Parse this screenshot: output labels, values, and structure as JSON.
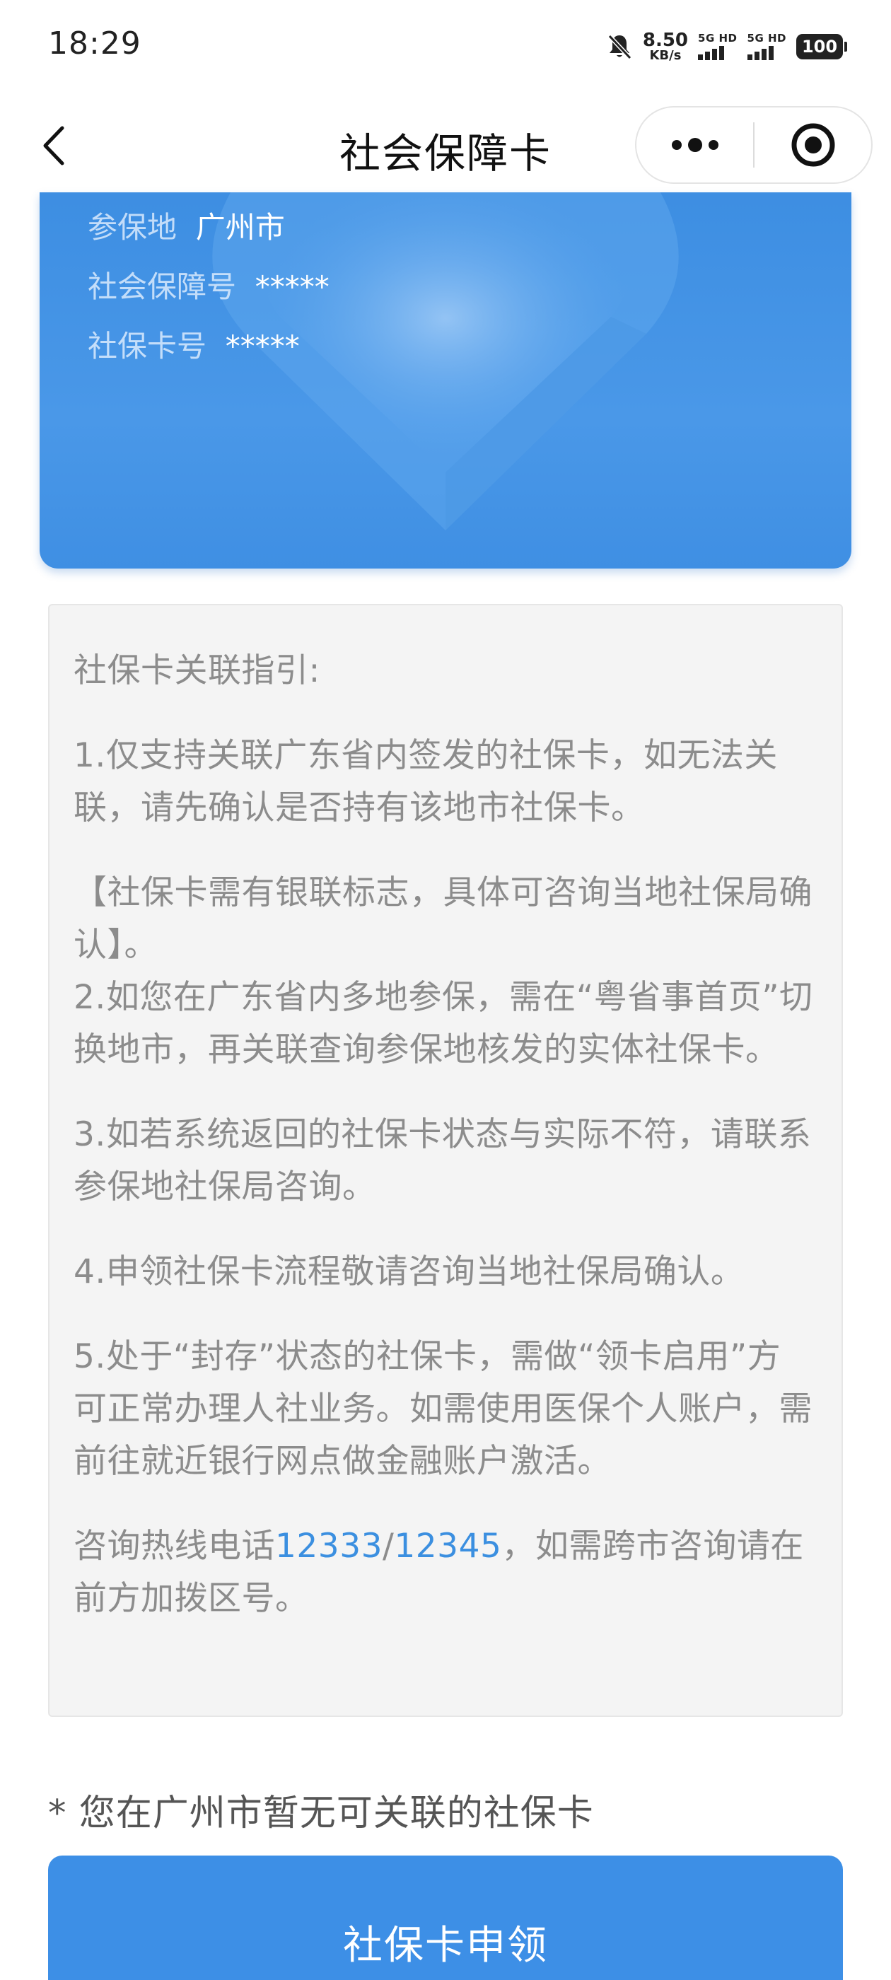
{
  "status_bar": {
    "time": "18:29",
    "net_speed_value": "8.50",
    "net_speed_unit": "KB/s",
    "signal1_label": "5G HD",
    "signal2_label": "5G HD",
    "battery": "100"
  },
  "nav": {
    "title": "社会保障卡"
  },
  "card": {
    "region_label": "参保地",
    "region_value": "广州市",
    "ss_number_label": "社会保障号",
    "ss_number_value": "*****",
    "card_number_label": "社保卡号",
    "card_number_value": "*****"
  },
  "guide": {
    "title": "社保卡关联指引:",
    "item1": "1.仅支持关联广东省内签发的社保卡，如无法关联，请先确认是否持有该地市社保卡。",
    "note": "【社保卡需有银联标志，具体可咨询当地社保局确认】。",
    "item2": "2.如您在广东省内多地参保，需在“粤省事首页”切换地市，再关联查询参保地核发的实体社保卡。",
    "item3": "3.如若系统返回的社保卡状态与实际不符，请联系参保地社保局咨询。",
    "item4": "4.申领社保卡流程敬请咨询当地社保局确认。",
    "item5": "5.处于“封存”状态的社保卡，需做“领卡启用”方可正常办理人社业务。如需使用医保个人账户，需前往就近银行网点做金融账户激活。",
    "hotline_prefix": "咨询热线电话",
    "hotline1": "12333",
    "hotline_sep": "/",
    "hotline2": "12345",
    "hotline_suffix": "，如需跨市咨询请在前方加拨区号。"
  },
  "notice": "* 您在广州市暂无可关联的社保卡",
  "apply_button": "社保卡申领",
  "colors": {
    "card_blue": "#4a98e8",
    "button_blue": "#3d8fe6",
    "link_blue": "#3b8fe0",
    "guide_text": "#8c8c8c"
  }
}
